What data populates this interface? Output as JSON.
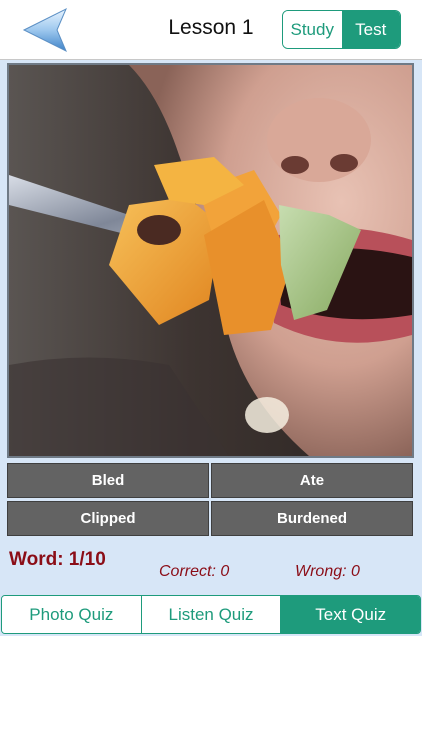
{
  "header": {
    "title": "Lesson 1",
    "back_icon": "back-arrow-icon",
    "segments": [
      {
        "label": "Study",
        "selected": false
      },
      {
        "label": "Test",
        "selected": true
      }
    ]
  },
  "photo": {
    "subject": "fruit-on-fork-photo"
  },
  "choices": [
    "Bled",
    "Ate",
    "Clipped",
    "Burdened"
  ],
  "stats": {
    "word": "Word: 1/10",
    "correct": "Correct: 0",
    "wrong": "Wrong: 0"
  },
  "quiz_tabs": [
    {
      "label": "Photo Quiz",
      "selected": false
    },
    {
      "label": "Listen Quiz",
      "selected": false
    },
    {
      "label": "Text Quiz",
      "selected": true
    }
  ],
  "colors": {
    "accent": "#1e9b7c",
    "stats_text": "#8b0d17",
    "content_bg": "#d7e6f7",
    "choice_bg": "#636363"
  }
}
